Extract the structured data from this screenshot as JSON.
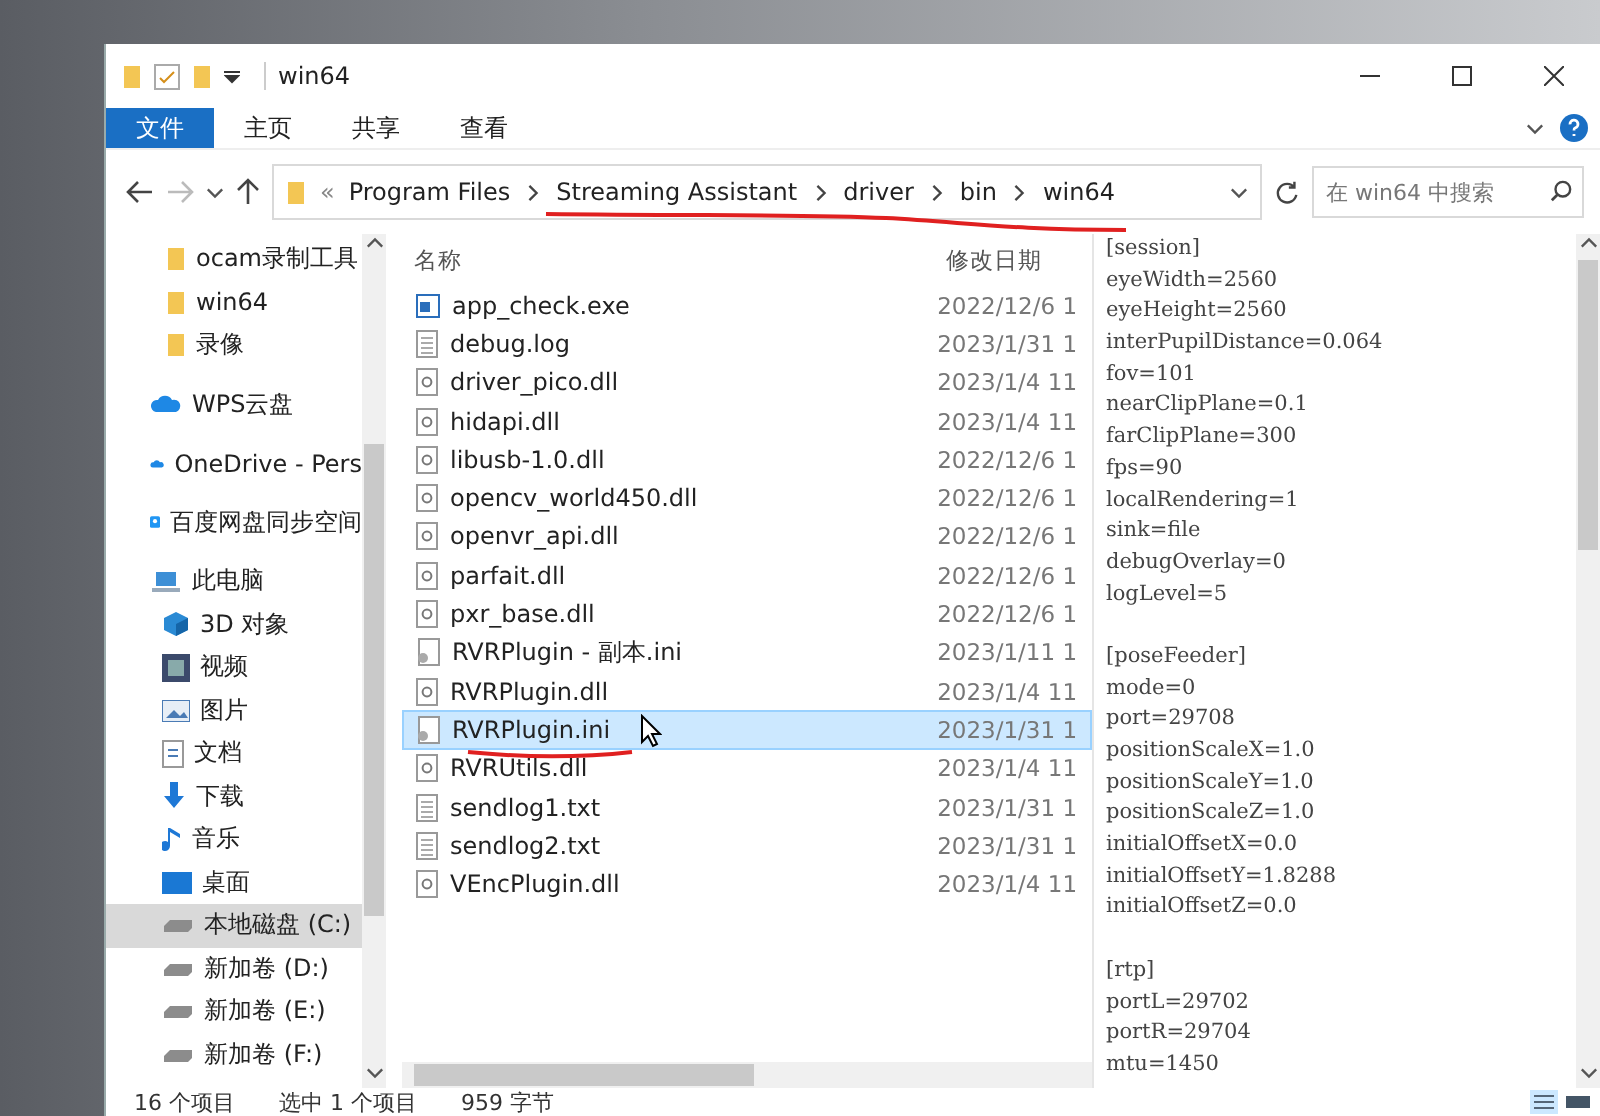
{
  "window": {
    "title": "win64"
  },
  "ribbon_tabs": [
    {
      "label": "文件",
      "selected": true
    },
    {
      "label": "主页",
      "selected": false
    },
    {
      "label": "共享",
      "selected": false
    },
    {
      "label": "查看",
      "selected": false
    }
  ],
  "address": {
    "overflow": "«",
    "segments": [
      "Program Files",
      "Streaming Assistant",
      "driver",
      "bin",
      "win64"
    ]
  },
  "search": {
    "placeholder": "在 win64 中搜索"
  },
  "nav": [
    {
      "label": "ocam录制工具",
      "kind": "folder",
      "selected": false
    },
    {
      "label": "win64",
      "kind": "folder",
      "selected": false
    },
    {
      "label": "录像",
      "kind": "folder",
      "selected": false
    },
    {
      "label": "WPS云盘",
      "kind": "cloud",
      "selected": false
    },
    {
      "label": "OneDrive - Pers",
      "kind": "cloud",
      "selected": false
    },
    {
      "label": "百度网盘同步空间",
      "kind": "sync",
      "selected": false
    },
    {
      "label": "此电脑",
      "kind": "pc",
      "selected": false
    },
    {
      "label": "3D 对象",
      "kind": "cube",
      "selected": false
    },
    {
      "label": "视频",
      "kind": "video",
      "selected": false
    },
    {
      "label": "图片",
      "kind": "picture",
      "selected": false
    },
    {
      "label": "文档",
      "kind": "doc",
      "selected": false
    },
    {
      "label": "下载",
      "kind": "download",
      "selected": false
    },
    {
      "label": "音乐",
      "kind": "music",
      "selected": false
    },
    {
      "label": "桌面",
      "kind": "desktop",
      "selected": false
    },
    {
      "label": "本地磁盘 (C:)",
      "kind": "drive",
      "selected": true
    },
    {
      "label": "新加卷 (D:)",
      "kind": "drive",
      "selected": false
    },
    {
      "label": "新加卷 (E:)",
      "kind": "drive",
      "selected": false
    },
    {
      "label": "新加卷 (F:)",
      "kind": "drive",
      "selected": false
    }
  ],
  "columns": [
    "名称",
    "修改日期"
  ],
  "files": [
    {
      "name": "app_check.exe",
      "date": "2022/12/6 1",
      "kind": "exe",
      "selected": false
    },
    {
      "name": "debug.log",
      "date": "2023/1/31 1",
      "kind": "text",
      "selected": false
    },
    {
      "name": "driver_pico.dll",
      "date": "2023/1/4 11",
      "kind": "dll",
      "selected": false
    },
    {
      "name": "hidapi.dll",
      "date": "2023/1/4 11",
      "kind": "dll",
      "selected": false
    },
    {
      "name": "libusb-1.0.dll",
      "date": "2022/12/6 1",
      "kind": "dll",
      "selected": false
    },
    {
      "name": "opencv_world450.dll",
      "date": "2022/12/6 1",
      "kind": "dll",
      "selected": false
    },
    {
      "name": "openvr_api.dll",
      "date": "2022/12/6 1",
      "kind": "dll",
      "selected": false
    },
    {
      "name": "parfait.dll",
      "date": "2022/12/6 1",
      "kind": "dll",
      "selected": false
    },
    {
      "name": "pxr_base.dll",
      "date": "2022/12/6 1",
      "kind": "dll",
      "selected": false
    },
    {
      "name": "RVRPlugin - 副本.ini",
      "date": "2023/1/11 1",
      "kind": "ini",
      "selected": false
    },
    {
      "name": "RVRPlugin.dll",
      "date": "2023/1/4 11",
      "kind": "dll",
      "selected": false
    },
    {
      "name": "RVRPlugin.ini",
      "date": "2023/1/31 1",
      "kind": "ini",
      "selected": true
    },
    {
      "name": "RVRUtils.dll",
      "date": "2023/1/4 11",
      "kind": "dll",
      "selected": false
    },
    {
      "name": "sendlog1.txt",
      "date": "2023/1/31 1",
      "kind": "text",
      "selected": false
    },
    {
      "name": "sendlog2.txt",
      "date": "2023/1/31 1",
      "kind": "text",
      "selected": false
    },
    {
      "name": "VEncPlugin.dll",
      "date": "2023/1/4 11",
      "kind": "dll",
      "selected": false
    }
  ],
  "preview_sections": [
    {
      "lines": [
        "[session]",
        "eyeWidth=2560",
        "eyeHeight=2560",
        "interPupilDistance=0.064",
        "fov=101",
        "nearClipPlane=0.1",
        "farClipPlane=300",
        "fps=90",
        "localRendering=1",
        "sink=file",
        "debugOverlay=0",
        "logLevel=5"
      ]
    },
    {
      "lines": [
        "[poseFeeder]",
        "mode=0",
        "port=29708",
        "positionScaleX=1.0",
        "positionScaleY=1.0",
        "positionScaleZ=1.0",
        "initialOffsetX=0.0",
        "initialOffsetY=1.8288",
        "initialOffsetZ=0.0"
      ]
    },
    {
      "lines": [
        "[rtp]",
        "portL=29702",
        "portR=29704",
        "mtu=1450"
      ]
    }
  ],
  "status_bar": {
    "count": "16 个项目",
    "selection": "选中 1 个项目",
    "size": "959 字节"
  }
}
